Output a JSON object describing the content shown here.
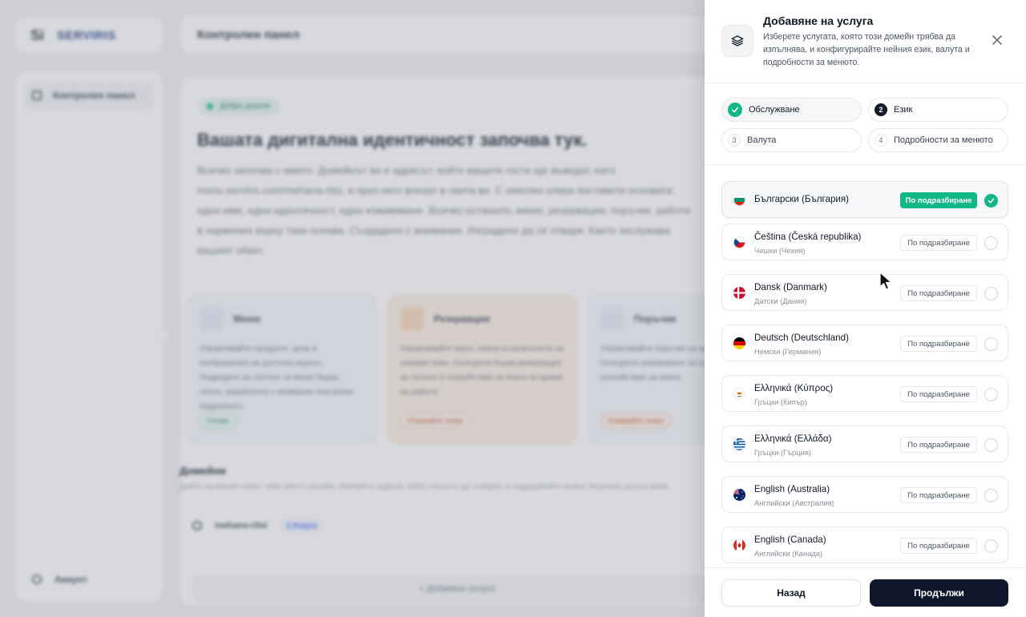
{
  "background": {
    "brand_mark": "Si",
    "brand_name": "SERVIRIS",
    "header_title": "Контролен панел",
    "sidebar_item": "Контролен панел",
    "account": "Акаунт",
    "pill": "Добре дошли",
    "hero_title": "Вашата дигитална идентичност започва тук.",
    "hero_text": "Всичко започва с името. Домейнът ви е адресът, който вашите гости ще въведат, като menu.serviris.com/mehana-ritsi, и през него влизат в света ви. С няколко клика поставете основата: едно име, една идентичност, едно изживяване. Всичко останало, меню, резервации, поръчки, работи в хармония върху тази основа. Създадено с внимание. Изградено да се отваря. Както заслужава вашият обект.",
    "cards": [
      {
        "title": "Меню",
        "text": "Управлявайте продукти, цени и изображения на достъпа изцяло. Подредете на гостите си меню бързо, лесно, изработено с внимание към всеки подробност.",
        "tag": "Готово"
      },
      {
        "title": "Резервации",
        "text": "Управлявайте маси, смени и наличности на някакво ниво. Осигурете бърза резервация за гостите и спокойствие за екипа по време на работа.",
        "tag": "Очаквайте скоро"
      },
      {
        "title": "Поръчки",
        "text": "Управлявайте поръчки на едно място. Осигурете изживяване за гостите и спокойствие за екипа.",
        "tag": "Очаквайте скоро"
      }
    ],
    "domains_title": "Домейни",
    "domains_subtitle": "Дайте на вашия обект свое място онлайн. Изберете адреса, който гостите ще отварят, и поддържайте всяка свързана услуга жива.",
    "domain_name": "mehana-ritsi",
    "domain_badge": "1 Услуга",
    "add_service": "+ Добавяне услуга"
  },
  "drawer": {
    "title": "Добавяне на услуга",
    "description": "Изберете услугата, която този домейн трябва да изпълнява, и конфигурирайте нейния език, валута и подробности за менюто.",
    "steps": [
      {
        "number": "",
        "label": "Обслужване",
        "state": "done"
      },
      {
        "number": "2",
        "label": "Език",
        "state": "active"
      },
      {
        "number": "3",
        "label": "Валута",
        "state": "todo"
      },
      {
        "number": "4",
        "label": "Подробности за менюто",
        "state": "todo"
      }
    ],
    "default_label": "По подразбиране",
    "languages": [
      {
        "name": "Български (България)",
        "native": "",
        "flag": "bg",
        "selected": true
      },
      {
        "name": "Čeština (Česká republika)",
        "native": "Чешки (Чехия)",
        "flag": "cz",
        "selected": false
      },
      {
        "name": "Dansk (Danmark)",
        "native": "Датски (Дания)",
        "flag": "dk",
        "selected": false
      },
      {
        "name": "Deutsch (Deutschland)",
        "native": "Немски (Германия)",
        "flag": "de",
        "selected": false
      },
      {
        "name": "Ελληνικά (Κύπρος)",
        "native": "Гръцки (Кипър)",
        "flag": "cy",
        "selected": false
      },
      {
        "name": "Ελληνικά (Ελλάδα)",
        "native": "Гръцки (Гърция)",
        "flag": "gr",
        "selected": false
      },
      {
        "name": "English (Australia)",
        "native": "Английски (Австралия)",
        "flag": "au",
        "selected": false
      },
      {
        "name": "English (Canada)",
        "native": "Английски (Канада)",
        "flag": "ca",
        "selected": false
      }
    ],
    "back_label": "Назад",
    "next_label": "Продължи"
  },
  "colors": {
    "accent_green": "#12b886",
    "primary_dark": "#0f172a"
  }
}
